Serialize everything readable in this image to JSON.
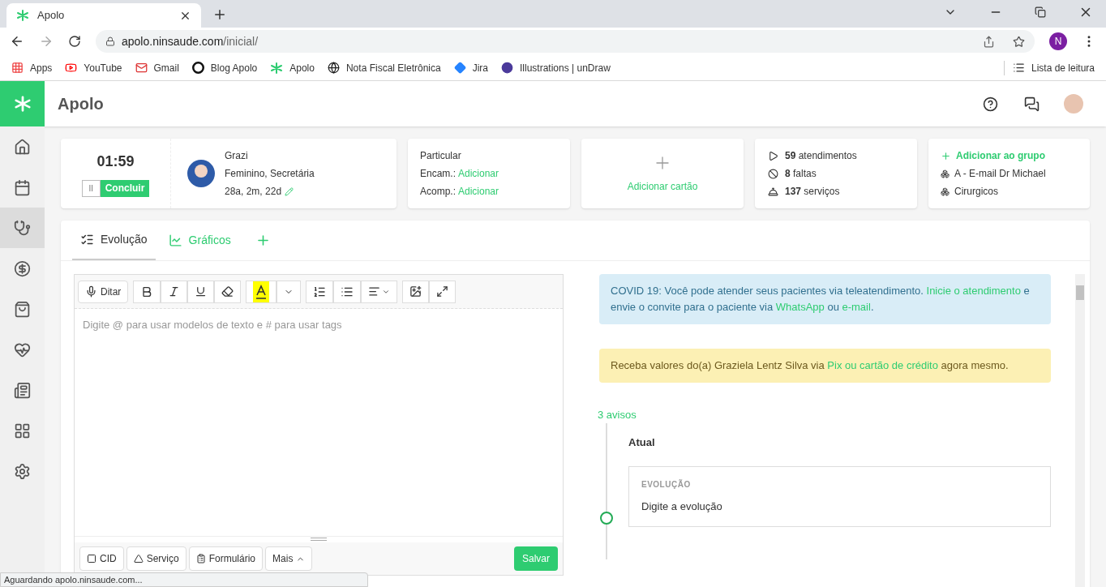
{
  "browser": {
    "tab": {
      "title": "Apolo"
    },
    "url": {
      "host": "apolo.ninsaude.com",
      "path": "/inicial/"
    },
    "profile": "N",
    "bookmarks": [
      "Apps",
      "YouTube",
      "Gmail",
      "Blog Apolo",
      "Apolo",
      "Nota Fiscal Eletrônica",
      "Jira",
      "Illustrations | unDraw"
    ],
    "reading_list": "Lista de leitura",
    "status": "Aguardando apolo.ninsaude.com..."
  },
  "app": {
    "title": "Apolo"
  },
  "sidebar": {
    "items": [
      {
        "selected": false
      },
      {
        "selected": false
      },
      {
        "selected": true
      },
      {
        "selected": false
      },
      {
        "selected": false
      },
      {
        "selected": false
      },
      {
        "selected": false
      },
      {
        "selected": false
      },
      {
        "selected": false
      }
    ]
  },
  "timer": {
    "time": "01:59",
    "pause": "II",
    "finish": "Concluir"
  },
  "patient": {
    "name": "Grazi",
    "details": "Feminino, Secretária",
    "age": "28a, 2m, 22d"
  },
  "insurance": {
    "plan": "Particular",
    "rows": [
      {
        "label": "Encam.:",
        "link": "Adicionar"
      },
      {
        "label": "Acomp.:",
        "link": "Adicionar"
      }
    ]
  },
  "add_card": {
    "label": "Adicionar cartão"
  },
  "stats": [
    "**59** atendimentos",
    "**8** faltas",
    "**137** serviços"
  ],
  "groups": {
    "add": "Adicionar ao grupo",
    "items": [
      "A - E-mail Dr Michael",
      "Cirurgicos"
    ]
  },
  "tabs": [
    {
      "label": "Evolução",
      "selected": true
    },
    {
      "label": "Gráficos",
      "selected": false
    }
  ],
  "editor": {
    "dictate": "Ditar",
    "placeholder": "Digite @ para usar modelos de texto e # para usar tags",
    "footer": [
      "CID",
      "Serviço",
      "Formulário",
      "Mais"
    ],
    "save": "Salvar"
  },
  "notices": [
    {
      "kind": "info",
      "parts": [
        {
          "text": "COVID 19: Você pode atender seus pacientes via teleatendimento. ",
          "link": false
        },
        {
          "text": "Inicie o atendimento",
          "link": true
        },
        {
          "text": " e envie o convite para o paciente via ",
          "link": false
        },
        {
          "text": "WhatsApp",
          "link": true
        },
        {
          "text": " ou ",
          "link": false
        },
        {
          "text": "e-mail",
          "link": true
        },
        {
          "text": ".",
          "link": false
        }
      ]
    },
    {
      "kind": "warning",
      "parts": [
        {
          "text": "Receba valores do(a) Graziela Lentz Silva via ",
          "link": false
        },
        {
          "text": "Pix ou cartão de crédito",
          "link": true
        },
        {
          "text": " agora mesmo.",
          "link": false
        }
      ]
    }
  ],
  "timeline": {
    "count": "3 avisos",
    "section": "Atual",
    "entry": {
      "type": "EVOLUÇÃO",
      "text": "Digite a evolução"
    }
  }
}
